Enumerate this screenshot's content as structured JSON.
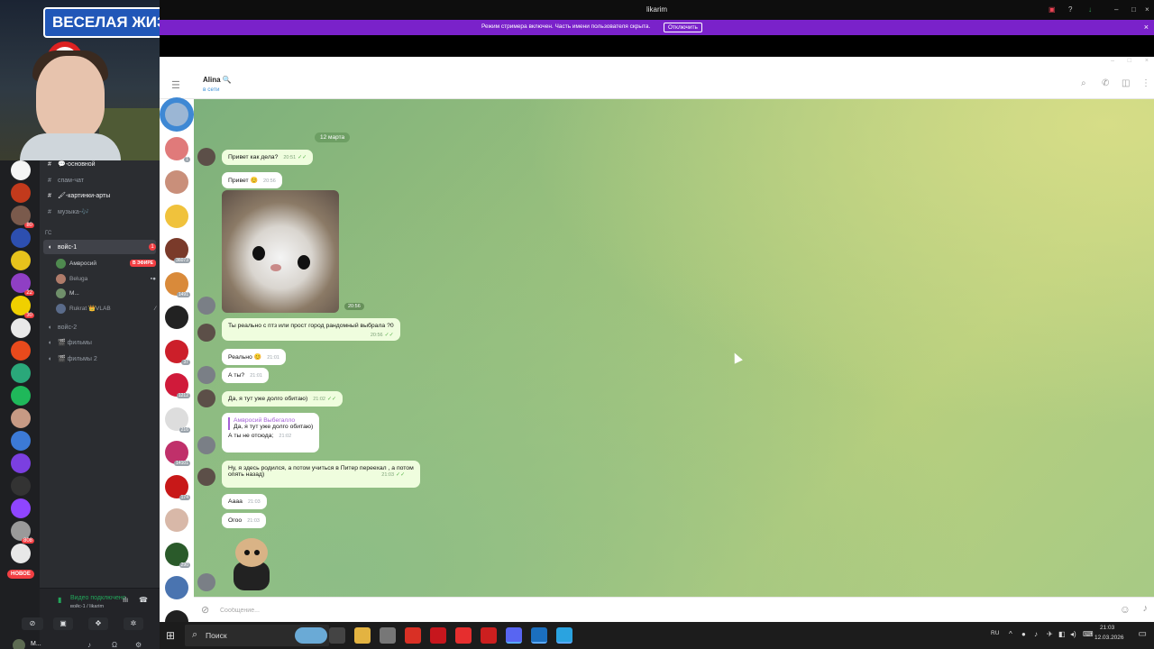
{
  "webcam": {
    "sign_text": "ВЕСЕЛАЯ ЖИЗ"
  },
  "discord": {
    "guilds": [
      {
        "color": "#f5f5f5",
        "badge": ""
      },
      {
        "color": "#c23a1c",
        "badge": ""
      },
      {
        "color": "#7a5a4c",
        "badge": "80"
      },
      {
        "color": "#2d4fb0",
        "badge": ""
      },
      {
        "color": "#e7c21c",
        "badge": ""
      },
      {
        "color": "#8f3fc4",
        "badge": "22"
      },
      {
        "color": "#f0d000",
        "badge": "30"
      },
      {
        "color": "#e9e9e9",
        "badge": ""
      },
      {
        "color": "#e84a1c",
        "badge": ""
      },
      {
        "color": "#2aa87a",
        "badge": ""
      },
      {
        "color": "#1fb85a",
        "badge": ""
      },
      {
        "color": "#c79a84",
        "badge": ""
      },
      {
        "color": "#3c7ad6",
        "badge": ""
      },
      {
        "color": "#7b3fe0",
        "badge": ""
      },
      {
        "color": "#333333",
        "badge": ""
      },
      {
        "color": "#8f45ff",
        "badge": ""
      },
      {
        "color": "#9a9a9a",
        "badge": "808"
      },
      {
        "color": "#e8e8e8",
        "badge": ""
      }
    ],
    "new_badge": "НОВОЕ",
    "channels": {
      "text": [
        {
          "name": "💬-основной",
          "highlight": true
        },
        {
          "name": "спам-чат",
          "highlight": false
        },
        {
          "name": "🖌-картинки-арты",
          "highlight": true
        },
        {
          "name": "музыка-🎶",
          "highlight": false
        }
      ],
      "category": "ГС",
      "voice1": {
        "name": "войс-1",
        "badge": "1"
      },
      "voice_users": [
        {
          "name": "Амвросий",
          "live": "В ЭФИРЕ"
        },
        {
          "name": "Beluga",
          "live": ""
        },
        {
          "name": "M...",
          "live": ""
        },
        {
          "name": "Rukrat 👑VLAB",
          "live": ""
        }
      ],
      "voice_others": [
        "войс-2",
        "🎬 фильмы",
        "🎬 фильмы 2"
      ]
    },
    "voice_status": "Видео подключено",
    "voice_sub": "войс-1 / likarim",
    "me_name": "M..."
  },
  "window": {
    "title": "likarim",
    "streamer_text": "Режим стримера включен. Часть имени пользователя скрыта.",
    "streamer_button": "Отключить"
  },
  "telegram": {
    "chat_name": "Alina 🔍",
    "chat_status": "в сети",
    "dialog_counts": [
      "",
      "1",
      "",
      "",
      "36073",
      "1491",
      "",
      "37",
      "1212",
      "216",
      "14101",
      "174",
      "",
      "290",
      "",
      ""
    ],
    "date_label": "12 марта",
    "messages": [
      {
        "id": "m1",
        "dir": "out",
        "text": "Привет как дела?",
        "time": "20:51"
      },
      {
        "id": "m2",
        "dir": "in",
        "text": "Привет 😊",
        "time": "20:56"
      },
      {
        "id": "m3",
        "dir": "out",
        "text": "Ты реально с птз или прост город рандомный выбрала ?0",
        "time": "20:56"
      },
      {
        "id": "m4",
        "dir": "in",
        "text": "Реально 😊",
        "time": "21:01"
      },
      {
        "id": "m5",
        "dir": "in",
        "text": "А ты?",
        "time": "21:01"
      },
      {
        "id": "m6",
        "dir": "out",
        "text": "Да, я тут уже долго обитаю)",
        "time": "21:02"
      },
      {
        "id": "m7",
        "dir": "in",
        "reply_name": "Амвросий Выбегалло",
        "reply_text": "Да, я тут уже долго обитаю)",
        "text": "А ты не отсюда;",
        "time": "21:02"
      },
      {
        "id": "m8",
        "dir": "out",
        "text": "Ну, я здесь родился, а потом учиться в Питер переехал , а потом",
        "text2": "опять назад)",
        "time": "21:03"
      },
      {
        "id": "m9",
        "dir": "in",
        "text": "Аааа",
        "time": "21:03"
      },
      {
        "id": "m10",
        "dir": "in",
        "text": "Огоо",
        "time": "21:03"
      }
    ],
    "photo_time": "20:56",
    "input_placeholder": "Сообщение..."
  },
  "taskbar": {
    "search_label": "Поиск",
    "apps": [
      {
        "color": "#6aaad6"
      },
      {
        "color": "#444444"
      },
      {
        "color": "#e3b341"
      },
      {
        "color": "#777777"
      },
      {
        "color": "#d93025"
      },
      {
        "color": "#c7161d"
      },
      {
        "color": "#e62e2e"
      },
      {
        "color": "#cc1f1f"
      },
      {
        "color": "#5865f2"
      },
      {
        "color": "#1b6fbf"
      },
      {
        "color": "#2aa3e0"
      }
    ],
    "lang": "RU",
    "time": "21:03",
    "date": "12.03.2026"
  }
}
